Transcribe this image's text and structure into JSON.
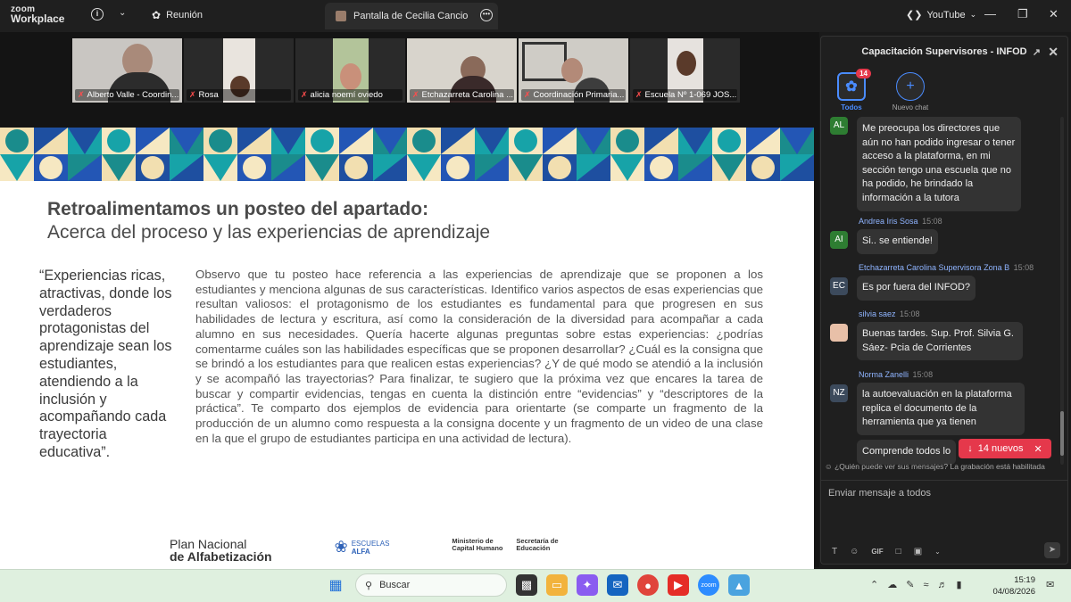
{
  "app": {
    "brand_top": "zoom",
    "brand_bottom": "Workplace",
    "meeting_label": "Reunión",
    "share_tab": "Pantalla de Cecilia Cancio",
    "youtube": "YouTube"
  },
  "participants": [
    {
      "name": "Alberto Valle - Coordin..."
    },
    {
      "name": "Rosa"
    },
    {
      "name": "alicia noemí oviedo"
    },
    {
      "name": "Etchazarreta Carolina ..."
    },
    {
      "name": "Coordinación Primaria..."
    },
    {
      "name": "Escuela Nº 1-069 JOS..."
    }
  ],
  "slide": {
    "title_bold": "Retroalimentamos un posteo del apartado:",
    "title_sub": "Acerca del proceso y las experiencias de aprendizaje",
    "quote": "“Experiencias ricas, atractivas, donde los verdaderos protagonistas del aprendizaje sean los estudiantes, atendiendo a la inclusión y acompañando cada trayectoria educativa”.",
    "body": "Observo que tu posteo hace referencia a las experiencias de aprendizaje que se proponen a los estudiantes y menciona algunas de sus características. Identifico varios aspectos de esas experiencias que resultan valiosos: el protagonismo de los estudiantes es fundamental para que progresen en sus habilidades de lectura y escritura, así como la consideración de la diversidad para acompañar a cada alumno en sus necesidades. Quería hacerte algunas preguntas sobre estas experiencias: ¿podrías comentarme cuáles son las habilidades específicas que se proponen desarrollar? ¿Cuál es la consigna que se brindó a los estudiantes para que realicen estas experiencias? ¿Y de qué modo se atendió a la inclusión y se acompañó las trayectorias? Para finalizar, te sugiero que la próxima vez que encares la tarea de buscar y compartir evidencias, tengas en cuenta la distinción entre “evidencias” y “descriptores de la práctica”. Te comparto dos ejemplos de evidencia para orientarte (se comparte un fragmento de la producción de un alumno como respuesta a la consigna docente y un fragmento de un video de una clase en la que el grupo de estudiantes participa en una actividad de lectura).",
    "logo_plan": "Plan Nacional",
    "logo_plan2": "de Alfabetización",
    "logo_alfa1": "ESCUELAS",
    "logo_alfa2": "ALFA",
    "logo_min": "Ministerio de Capital Humano",
    "logo_sec": "Secretaría de Educación"
  },
  "chat": {
    "title": "Capacitación Supervisores - INFOD",
    "tab_all": "Todos",
    "tab_all_badge": "14",
    "tab_new": "Nuevo chat",
    "messages": [
      {
        "initials": "AL",
        "sender": "",
        "time": "",
        "text": "Me preocupa los directores que aún no han podido ingresar o tener acceso a la plataforma, en mi sección tengo una escuela que no ha podido, he brindado la información a la tutora"
      },
      {
        "initials": "AI",
        "sender": "Andrea Iris Sosa",
        "time": "15:08",
        "text": "Si.. se entiende!"
      },
      {
        "initials": "EC",
        "sender": "Etchazarreta Carolina Supervisora Zona B",
        "time": "15:08",
        "text": "Es por fuera del INFOD?"
      },
      {
        "initials": "",
        "sender": "silvia saez",
        "time": "15:08",
        "text": "Buenas tardes. Sup. Prof. Silvia G. Sáez- Pcia de Corrientes"
      },
      {
        "initials": "NZ",
        "sender": "Norma Zanelli",
        "time": "15:08",
        "text": "la autoevaluación en la plataforma replica el documento de la herramienta que ya tienen"
      },
      {
        "initials": "",
        "sender": "",
        "time": "",
        "text": "Comprende todos lo"
      }
    ],
    "new_messages": "14 nuevos",
    "who_can_see": "¿Quién puede ver sus mensajes? La grabación está habilitada",
    "input_placeholder": "Enviar mensaje a todos",
    "gif": "GIF"
  },
  "taskbar": {
    "search_placeholder": "Buscar",
    "time": "15:19",
    "date": "04/08/2026"
  }
}
